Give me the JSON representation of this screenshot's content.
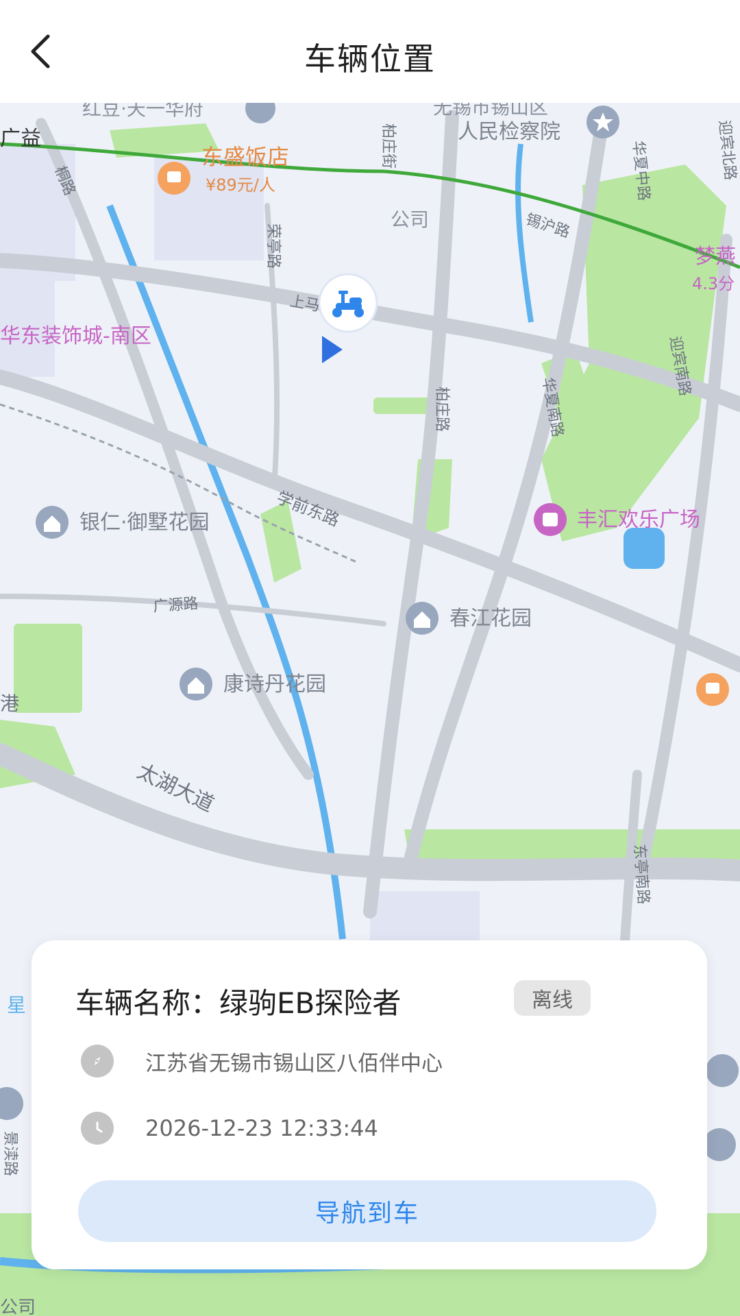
{
  "header": {
    "title": "车辆位置"
  },
  "map": {
    "labels": {
      "hongdou": "红豆·天一华府",
      "jianchayuan_1": "无锡市锡山区",
      "jianchayuan_2": "人民检察院",
      "guangyi": "广益",
      "dongsheng": "东盛饭店",
      "dongsheng_price": "¥89元/人",
      "gongsi": "公司",
      "huadong": "华东装饰城-南区",
      "mengyan": "梦燕",
      "mengyan_time": "4.3分",
      "yinren": "银仁·御墅花园",
      "fenghui": "丰汇欢乐广场",
      "chunjiang": "春江花园",
      "kangshidan": "康诗丹花园",
      "road_tonglu": "桐路",
      "road_bozhuangjie": "柏庄街",
      "road_rongting": "荣亭路",
      "road_shangma": "上马",
      "road_xihu": "锡沪路",
      "road_huaxiazhong": "华夏中路",
      "road_yingbinbei": "迎宾北路",
      "road_yingbinnan": "迎宾南路",
      "road_bozhuang": "柏庄路",
      "road_huaxianan": "华夏南路",
      "road_xueqiandong": "学前东路",
      "road_guangyuan": "广源路",
      "road_taihu": "太湖大道",
      "road_dongting": "东亭南路",
      "road_jingdu": "景渎路",
      "edge_xing": "星",
      "edge_gang": "港",
      "edge_gongsi_bottom": "公司"
    }
  },
  "card": {
    "vehicle_name": "车辆名称：绿驹EB探险者",
    "status": "离线",
    "address": "江苏省无锡市锡山区八佰伴中心",
    "timestamp": "2026-12-23 12:33:44",
    "nav_button": "导航到车"
  },
  "colors": {
    "accent": "#2f86ea",
    "button_bg": "#dbe9fb",
    "road": "#c9ced6",
    "green": "#b4e59a",
    "water": "#5fb2ee",
    "poi_pink": "#c765c4"
  }
}
